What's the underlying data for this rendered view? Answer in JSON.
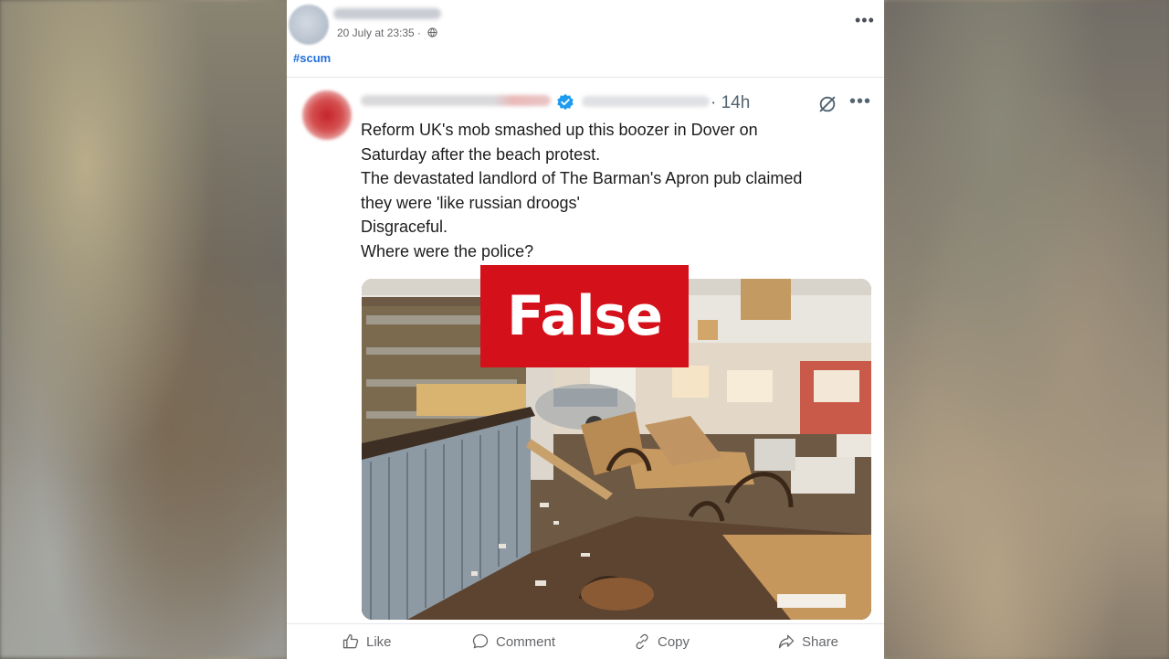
{
  "post": {
    "timestamp": "20 July at 23:35 ·",
    "hashtag": "#scum",
    "menu_glyph": "•••"
  },
  "embedded_tweet": {
    "age": "· 14h",
    "menu_glyph": "•••",
    "lines": [
      "Reform UK's mob smashed up this boozer in Dover on",
      "Saturday after the beach protest.",
      "The devastated landlord of The Barman's Apron pub claimed",
      "they were 'like russian droogs'",
      "Disgraceful.",
      "Where were the police?"
    ]
  },
  "fact_check": {
    "label": "False",
    "color": "#d4101a"
  },
  "actions": {
    "like": "Like",
    "comment": "Comment",
    "copy": "Copy",
    "share": "Share"
  },
  "icons": [
    "globe-icon",
    "verified-badge-icon",
    "grok-icon",
    "more-options-icon",
    "like-icon",
    "comment-icon",
    "copy-link-icon",
    "share-icon"
  ]
}
